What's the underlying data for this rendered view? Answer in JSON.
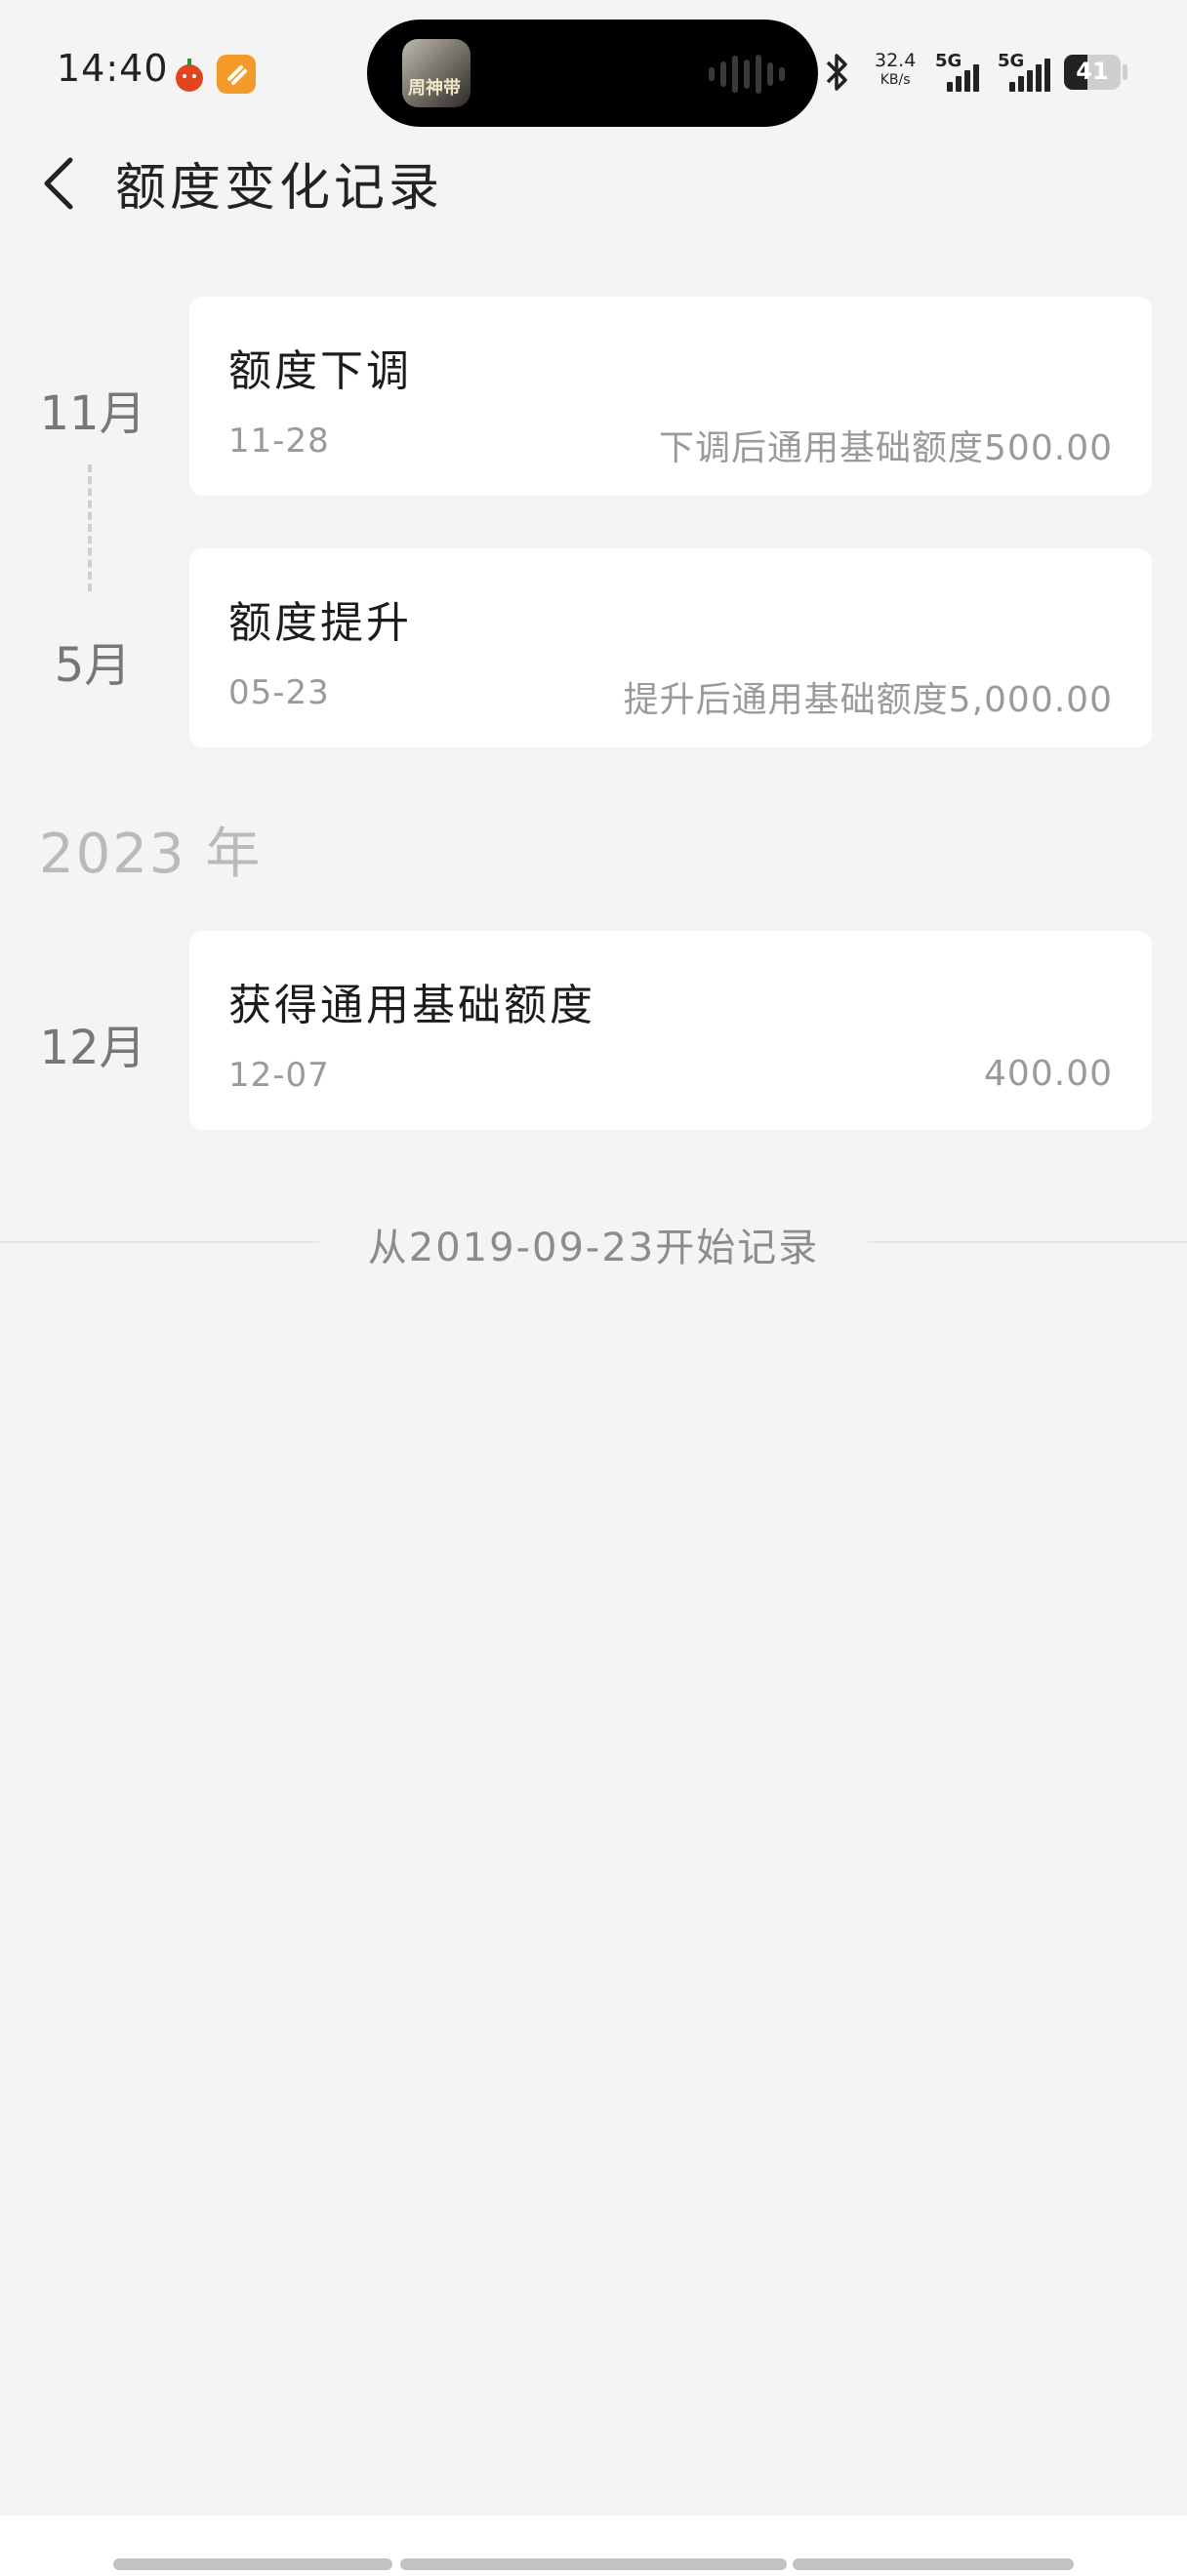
{
  "status_bar": {
    "time": "14:40",
    "app_icons": [
      "tomato-novel-icon",
      "notes-app-icon"
    ],
    "island_media_caption": "周神带",
    "net_speed": "32.4",
    "net_speed_unit": "KB/s",
    "sim1_label": "5G",
    "sim2_label": "5G",
    "battery": "41",
    "battery_level": 0.41
  },
  "header": {
    "title": "额度变化记录",
    "back_icon": "chevron-left-icon"
  },
  "timeline": {
    "year_label": "2023 年",
    "groups": [
      {
        "month": "11月",
        "title": "额度下调",
        "date": "11-28",
        "desc": "下调后通用基础额度500.00"
      },
      {
        "month": "5月",
        "title": "额度提升",
        "date": "05-23",
        "desc": "提升后通用基础额度5,000.00"
      },
      {
        "month": "12月",
        "title": "获得通用基础额度",
        "date": "12-07",
        "desc": "400.00"
      }
    ],
    "footer": "从2019-09-23开始记录"
  },
  "colors": {
    "background": "#f4f4f4",
    "card": "#ffffff",
    "primary_text": "#222222",
    "secondary_text": "#9a9a9a",
    "year_text": "#b9b9be"
  }
}
